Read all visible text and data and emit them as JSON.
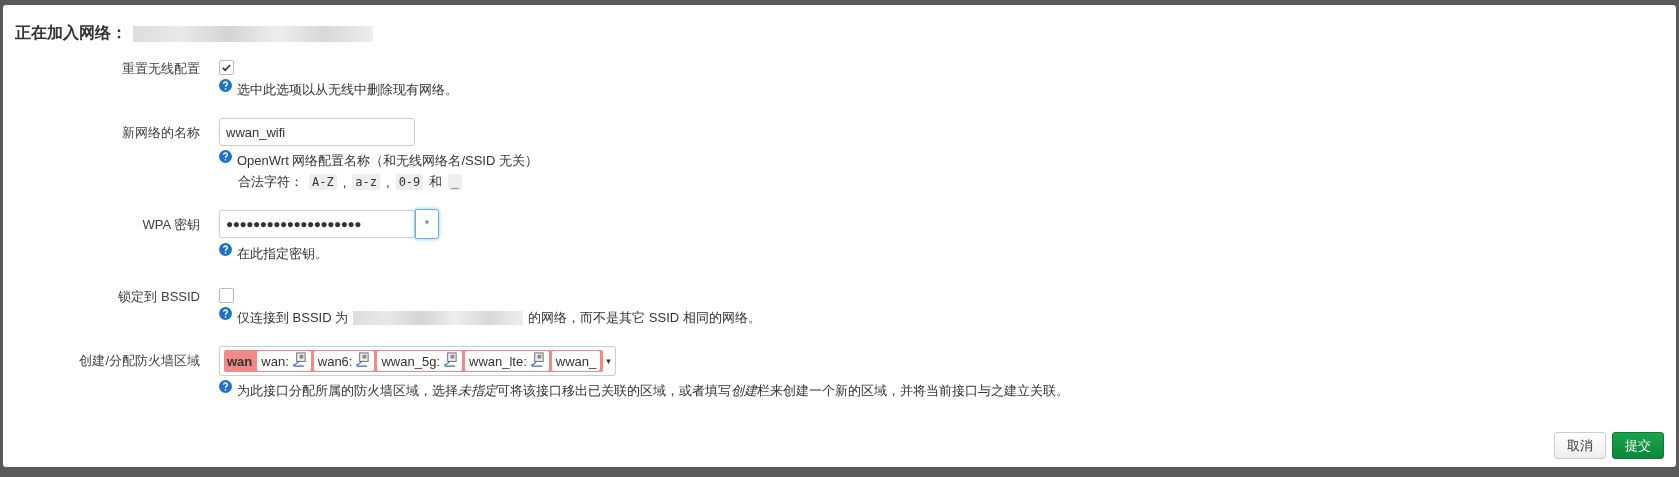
{
  "dialog": {
    "title": "正在加入网络："
  },
  "fields": [
    {
      "kind": "checkbox",
      "label": "重置无线配置",
      "checked": true,
      "help": [
        {
          "kind": "text",
          "text": "选中此选项以从无线中删除现有网络。"
        }
      ]
    },
    {
      "kind": "text",
      "label": "新网络的名称",
      "value": "wwan_wifi",
      "help": [
        {
          "kind": "text",
          "text": "OpenWrt 网络配置名称（和无线网络名/SSID 无关）"
        },
        {
          "kind": "chars",
          "parts": [
            {
              "kind": "text",
              "text": "合法字符："
            },
            {
              "kind": "code",
              "text": "A-Z"
            },
            {
              "kind": "text",
              "text": ","
            },
            {
              "kind": "code",
              "text": "a-z"
            },
            {
              "kind": "text",
              "text": ","
            },
            {
              "kind": "code",
              "text": "0-9"
            },
            {
              "kind": "text",
              "text": "和"
            },
            {
              "kind": "code",
              "text": "_"
            }
          ]
        }
      ]
    },
    {
      "kind": "password",
      "label": "WPA 密钥",
      "value": "●●●●●●●●●●●●●●●●●●●●",
      "reveal": "*",
      "help": [
        {
          "kind": "text",
          "text": "在此指定密钥。"
        }
      ]
    },
    {
      "kind": "checkbox",
      "label": "锁定到 BSSID",
      "checked": false,
      "help": [
        {
          "kind": "redacted",
          "before": "仅连接到 BSSID 为",
          "after": "的网络，而不是其它 SSID 相同的网络。"
        }
      ]
    },
    {
      "kind": "zone",
      "label": "创建/分配防火墙区域",
      "zone": {
        "name": "wan",
        "color": "#f08a8a"
      },
      "interfaces": [
        "wan:",
        "wan6:",
        "wwan_5g:",
        "wwan_lte:",
        "wwan_"
      ],
      "caret": "▾",
      "help": [
        {
          "kind": "styled",
          "parts": [
            {
              "kind": "text",
              "text": "为此接口分配所属的防火墙区域，选择"
            },
            {
              "kind": "italic",
              "text": "未指定"
            },
            {
              "kind": "text",
              "text": "可将该接口移出已关联的区域，或者填写"
            },
            {
              "kind": "italic",
              "text": "创建"
            },
            {
              "kind": "text",
              "text": "栏来创建一个新的区域，并将当前接口与之建立关联。"
            }
          ]
        }
      ]
    }
  ],
  "buttons": [
    {
      "label": "取消",
      "kind": "cancel"
    },
    {
      "label": "提交",
      "kind": "submit"
    }
  ]
}
